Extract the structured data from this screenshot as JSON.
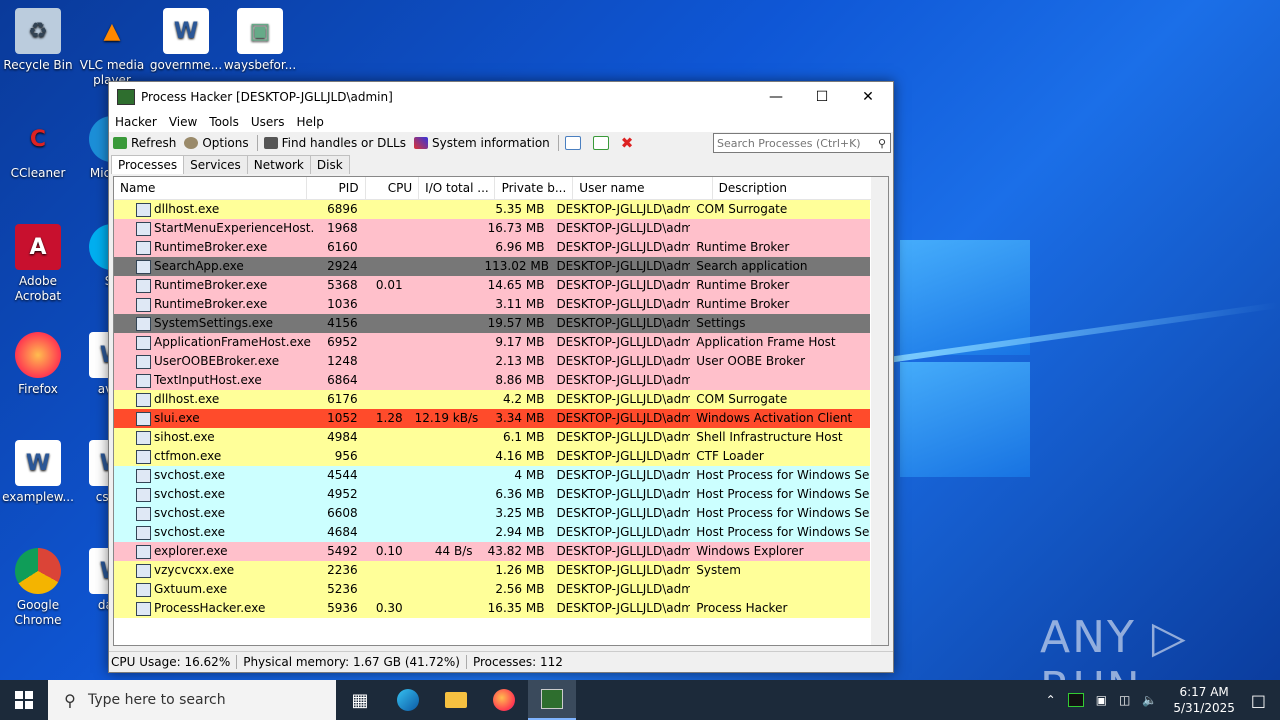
{
  "desktop": {
    "icons": [
      {
        "label": "Recycle Bin",
        "icon": "recycle-bin-icon"
      },
      {
        "label": "VLC media player",
        "icon": "vlc-icon"
      },
      {
        "label": "governme...",
        "icon": "word-doc-icon"
      },
      {
        "label": "waysbefor...",
        "icon": "image-file-icon"
      },
      {
        "label": "CCleaner",
        "icon": "ccleaner-icon"
      },
      {
        "label": "Micr Ed",
        "icon": "edge-icon"
      },
      {
        "label": "Adobe Acrobat",
        "icon": "acrobat-icon"
      },
      {
        "label": "Sk",
        "icon": "skype-icon"
      },
      {
        "label": "Firefox",
        "icon": "firefox-icon"
      },
      {
        "label": "avail",
        "icon": "word-doc-icon"
      },
      {
        "label": "examplew...",
        "icon": "word-doc-icon"
      },
      {
        "label": "cstan",
        "icon": "word-doc-icon"
      },
      {
        "label": "Google Chrome",
        "icon": "chrome-icon"
      },
      {
        "label": "days",
        "icon": "word-doc-icon"
      }
    ],
    "watermark": "ANY ▷ RUN"
  },
  "window": {
    "title": "Process Hacker [DESKTOP-JGLLJLD\\admin]",
    "menu": [
      "Hacker",
      "View",
      "Tools",
      "Users",
      "Help"
    ],
    "toolbar": {
      "refresh": "Refresh",
      "options": "Options",
      "find_handles": "Find handles or DLLs",
      "sysinfo": "System information"
    },
    "search_placeholder": "Search Processes (Ctrl+K)",
    "tabs": [
      "Processes",
      "Services",
      "Network",
      "Disk"
    ],
    "columns": [
      "Name",
      "PID",
      "CPU",
      "I/O total ...",
      "Private b...",
      "User name",
      "Description"
    ],
    "processes": [
      {
        "name": "dllhost.exe",
        "pid": "6896",
        "cpu": "",
        "io": "",
        "priv": "5.35 MB",
        "user": "DESKTOP-JGLLJLD\\admi",
        "desc": "COM Surrogate",
        "color": "#ffff99"
      },
      {
        "name": "StartMenuExperienceHost....",
        "pid": "1968",
        "cpu": "",
        "io": "",
        "priv": "16.73 MB",
        "user": "DESKTOP-JGLLJLD\\admi",
        "desc": "",
        "color": "#ffc0cb"
      },
      {
        "name": "RuntimeBroker.exe",
        "pid": "6160",
        "cpu": "",
        "io": "",
        "priv": "6.96 MB",
        "user": "DESKTOP-JGLLJLD\\admi",
        "desc": "Runtime Broker",
        "color": "#ffc0cb"
      },
      {
        "name": "SearchApp.exe",
        "pid": "2924",
        "cpu": "",
        "io": "",
        "priv": "113.02 MB",
        "user": "DESKTOP-JGLLJLD\\admi",
        "desc": "Search application",
        "color": "#777777"
      },
      {
        "name": "RuntimeBroker.exe",
        "pid": "5368",
        "cpu": "0.01",
        "io": "",
        "priv": "14.65 MB",
        "user": "DESKTOP-JGLLJLD\\admi",
        "desc": "Runtime Broker",
        "color": "#ffc0cb"
      },
      {
        "name": "RuntimeBroker.exe",
        "pid": "1036",
        "cpu": "",
        "io": "",
        "priv": "3.11 MB",
        "user": "DESKTOP-JGLLJLD\\admi",
        "desc": "Runtime Broker",
        "color": "#ffc0cb"
      },
      {
        "name": "SystemSettings.exe",
        "pid": "4156",
        "cpu": "",
        "io": "",
        "priv": "19.57 MB",
        "user": "DESKTOP-JGLLJLD\\admi",
        "desc": "Settings",
        "color": "#777777"
      },
      {
        "name": "ApplicationFrameHost.exe",
        "pid": "6952",
        "cpu": "",
        "io": "",
        "priv": "9.17 MB",
        "user": "DESKTOP-JGLLJLD\\admi",
        "desc": "Application Frame Host",
        "color": "#ffc0cb"
      },
      {
        "name": "UserOOBEBroker.exe",
        "pid": "1248",
        "cpu": "",
        "io": "",
        "priv": "2.13 MB",
        "user": "DESKTOP-JGLLJLD\\admi",
        "desc": "User OOBE Broker",
        "color": "#ffc0cb"
      },
      {
        "name": "TextInputHost.exe",
        "pid": "6864",
        "cpu": "",
        "io": "",
        "priv": "8.86 MB",
        "user": "DESKTOP-JGLLJLD\\admi",
        "desc": "",
        "color": "#ffc0cb"
      },
      {
        "name": "dllhost.exe",
        "pid": "6176",
        "cpu": "",
        "io": "",
        "priv": "4.2 MB",
        "user": "DESKTOP-JGLLJLD\\admi",
        "desc": "COM Surrogate",
        "color": "#ffff99"
      },
      {
        "name": "slui.exe",
        "pid": "1052",
        "cpu": "1.28",
        "io": "12.19 kB/s",
        "priv": "3.34 MB",
        "user": "DESKTOP-JGLLJLD\\admi",
        "desc": "Windows Activation Client",
        "color": "#ff4b2b"
      },
      {
        "name": "sihost.exe",
        "pid": "4984",
        "cpu": "",
        "io": "",
        "priv": "6.1 MB",
        "user": "DESKTOP-JGLLJLD\\admi",
        "desc": "Shell Infrastructure Host",
        "color": "#ffff99"
      },
      {
        "name": "ctfmon.exe",
        "pid": "956",
        "cpu": "",
        "io": "",
        "priv": "4.16 MB",
        "user": "DESKTOP-JGLLJLD\\admi",
        "desc": "CTF Loader",
        "color": "#ffff99"
      },
      {
        "name": "svchost.exe",
        "pid": "4544",
        "cpu": "",
        "io": "",
        "priv": "4 MB",
        "user": "DESKTOP-JGLLJLD\\admi",
        "desc": "Host Process for Windows Ser...",
        "color": "#ccffff"
      },
      {
        "name": "svchost.exe",
        "pid": "4952",
        "cpu": "",
        "io": "",
        "priv": "6.36 MB",
        "user": "DESKTOP-JGLLJLD\\admi",
        "desc": "Host Process for Windows Ser...",
        "color": "#ccffff"
      },
      {
        "name": "svchost.exe",
        "pid": "6608",
        "cpu": "",
        "io": "",
        "priv": "3.25 MB",
        "user": "DESKTOP-JGLLJLD\\admi",
        "desc": "Host Process for Windows Ser...",
        "color": "#ccffff"
      },
      {
        "name": "svchost.exe",
        "pid": "4684",
        "cpu": "",
        "io": "",
        "priv": "2.94 MB",
        "user": "DESKTOP-JGLLJLD\\admi",
        "desc": "Host Process for Windows Ser...",
        "color": "#ccffff"
      },
      {
        "name": "explorer.exe",
        "pid": "5492",
        "cpu": "0.10",
        "io": "44 B/s",
        "priv": "43.82 MB",
        "user": "DESKTOP-JGLLJLD\\admi",
        "desc": "Windows Explorer",
        "color": "#ffc0cb"
      },
      {
        "name": "vzycvcxx.exe",
        "pid": "2236",
        "cpu": "",
        "io": "",
        "priv": "1.26 MB",
        "user": "DESKTOP-JGLLJLD\\admi",
        "desc": "System",
        "color": "#ffff99"
      },
      {
        "name": "Gxtuum.exe",
        "pid": "5236",
        "cpu": "",
        "io": "",
        "priv": "2.56 MB",
        "user": "DESKTOP-JGLLJLD\\admi",
        "desc": "",
        "color": "#ffff99"
      },
      {
        "name": "ProcessHacker.exe",
        "pid": "5936",
        "cpu": "0.30",
        "io": "",
        "priv": "16.35 MB",
        "user": "DESKTOP-JGLLJLD\\admi",
        "desc": "Process Hacker",
        "color": "#ffff99"
      }
    ],
    "status": {
      "cpu": "CPU Usage: 16.62%",
      "mem": "Physical memory: 1.67 GB (41.72%)",
      "procs": "Processes: 112"
    }
  },
  "taskbar": {
    "search_placeholder": "Type here to search",
    "time": "6:17 AM",
    "date": "5/31/2025"
  }
}
